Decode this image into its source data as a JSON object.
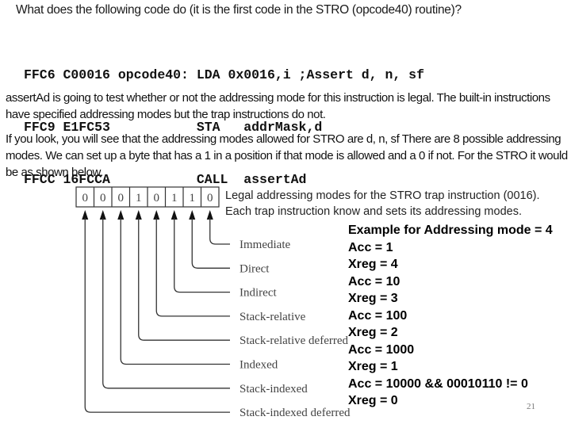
{
  "question": "What does the following code do (it is the first code in the STRO (opcode40) routine)?",
  "code_lines": [
    "FFC6 C00016 opcode40: LDA 0x0016,i ;Assert d, n, sf",
    "FFC9 E1FC53           STA   addrMask,d",
    "FFCC 16FCCA           CALL  assertAd"
  ],
  "paragraphs": [
    "assertAd is going to test whether or not the addressing mode for this instruction is legal.  The built-in instructions have specified addressing modes but the trap instructions do not.",
    "If you look, you will see that the addressing modes allowed for STRO are  d, n, sf  There are 8 possible addressing modes.  We can set up a byte that has a 1 in a position if that mode is allowed and a 0 if not.  For the STRO it would be as shown below."
  ],
  "diagram": {
    "bits": [
      "0",
      "0",
      "0",
      "1",
      "0",
      "1",
      "1",
      "0"
    ],
    "modes": [
      "Immediate",
      "Direct",
      "Indirect",
      "Stack-relative",
      "Stack-relative deferred",
      "Indexed",
      "Stack-indexed",
      "Stack-indexed deferred"
    ]
  },
  "legal_note": "Legal addressing modes for the STRO trap instruction (0016). Each trap instruction know and sets its addressing modes.",
  "example": {
    "title": "Example for Addressing mode = 4",
    "lines": [
      "Acc = 1",
      "Xreg = 4",
      "Acc = 10",
      "Xreg = 3",
      "Acc = 100",
      "Xreg = 2",
      "Acc = 1000",
      "Xreg = 1",
      "Acc = 10000 && 00010110 != 0",
      "Xreg = 0"
    ]
  },
  "page_number": "21"
}
